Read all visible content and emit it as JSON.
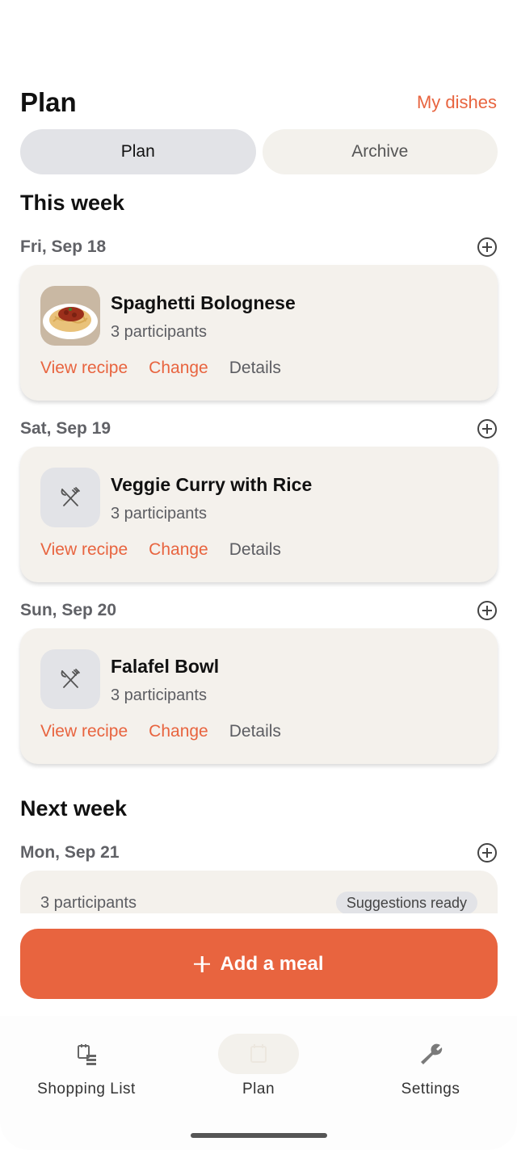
{
  "header": {
    "title": "Plan",
    "my_dishes_label": "My dishes"
  },
  "tabs": [
    {
      "label": "Plan",
      "active": true
    },
    {
      "label": "Archive",
      "active": false
    }
  ],
  "sections": {
    "this_week": "This week",
    "next_week": "Next week"
  },
  "days": [
    {
      "label": "Fri, Sep 18",
      "meal": {
        "name": "Spaghetti Bolognese",
        "participants": "3 participants",
        "thumb": "spaghetti-photo"
      }
    },
    {
      "label": "Sat, Sep 19",
      "meal": {
        "name": "Veggie Curry with Rice",
        "participants": "3 participants",
        "thumb": "utensils-icon"
      }
    },
    {
      "label": "Sun, Sep 20",
      "meal": {
        "name": "Falafel Bowl",
        "participants": "3 participants",
        "thumb": "utensils-icon"
      }
    },
    {
      "label": "Mon, Sep 21",
      "partial": {
        "participants": "3 participants",
        "badge": "Suggestions ready"
      }
    }
  ],
  "card_actions": {
    "view_recipe": "View recipe",
    "change": "Change",
    "details": "Details"
  },
  "add_meal_label": "Add a meal",
  "bottom_nav": [
    {
      "label": "Shopping List",
      "icon": "shopping-list-icon"
    },
    {
      "label": "Plan",
      "icon": "plan-icon",
      "active": true
    },
    {
      "label": "Settings",
      "icon": "wrench-icon"
    }
  ],
  "colors": {
    "accent": "#e8643f",
    "card_bg": "#f4f1ec",
    "tab_active": "#e2e3e7"
  }
}
